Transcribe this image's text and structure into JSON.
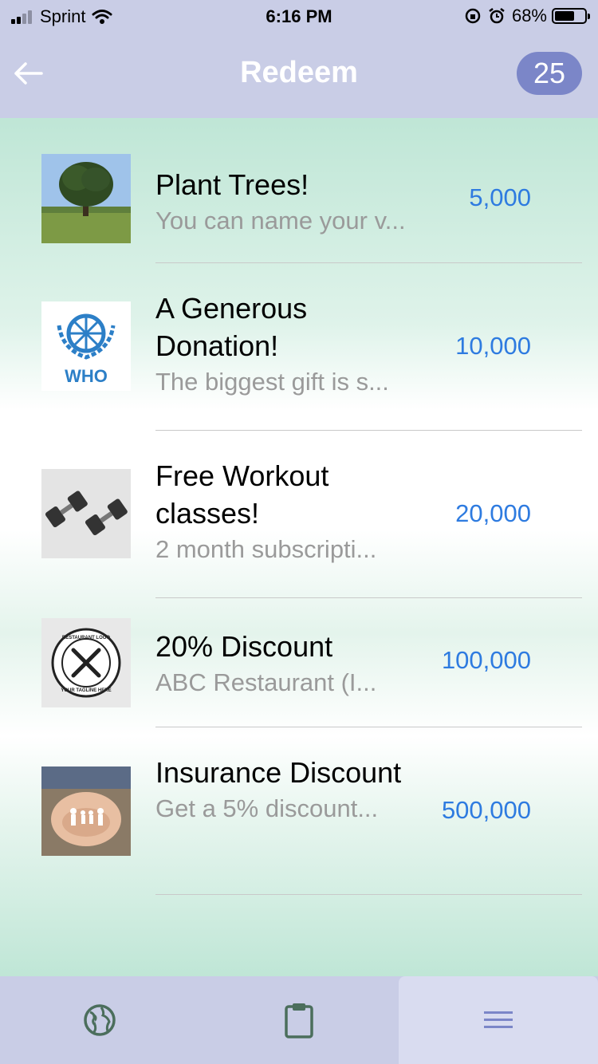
{
  "status_bar": {
    "carrier": "Sprint",
    "time": "6:16 PM",
    "battery": "68%",
    "battery_level": 0.68
  },
  "nav": {
    "title": "Redeem",
    "points": "25"
  },
  "rewards": [
    {
      "title": "Plant Trees!",
      "subtitle": "You can name your v...",
      "points": "5,000",
      "image": "tree-image"
    },
    {
      "title": "A Generous Donation!",
      "subtitle": "The biggest gift is s...",
      "points": "10,000",
      "image": "who-logo-image"
    },
    {
      "title": "Free Workout classes!",
      "subtitle": "2 month subscripti...",
      "points": "20,000",
      "image": "dumbbells-image"
    },
    {
      "title": "20% Discount",
      "subtitle": "ABC Restaurant (I...",
      "points": "100,000",
      "image": "restaurant-logo-image"
    },
    {
      "title": "Insurance Discount",
      "subtitle": "Get a 5% discount...",
      "points": "500,000",
      "image": "hands-family-image"
    }
  ],
  "thumb_text": {
    "who": "WHO",
    "restaurant_top": "RESTAURANT LOGO",
    "restaurant_bottom": "YOUR TAGLINE HERE"
  },
  "tabs": [
    {
      "name": "globe-icon",
      "active": false
    },
    {
      "name": "clipboard-icon",
      "active": false
    },
    {
      "name": "menu-icon",
      "active": true
    }
  ],
  "colors": {
    "header_bg": "#c9cde6",
    "badge_bg": "#7b86c8",
    "points_text": "#2e7be0",
    "tab_icon": "#4b6e5c"
  }
}
